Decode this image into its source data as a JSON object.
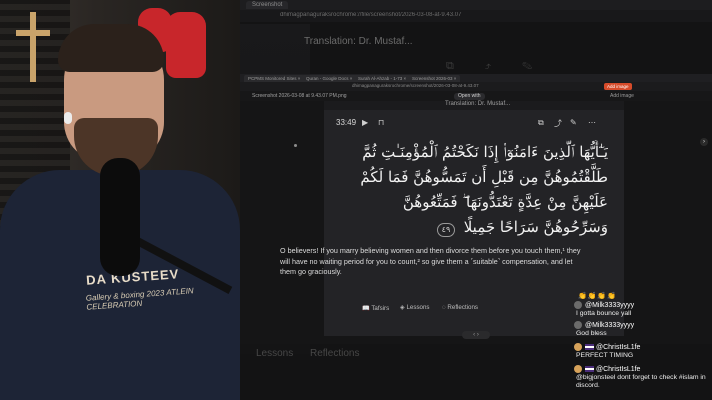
{
  "webcam": {
    "hoodie_title": "DA KUSTEEV",
    "hoodie_subtitle": "Gallery & boxing 2023 ATLEIN CELEBRATION"
  },
  "background_browser": {
    "tab_label": "Screenshot",
    "url": "dhimagpanaguraksrochrome://file/screenshot/2026-03-08-at-9.43.07",
    "translation_title": "Translation: Dr. Mustaf...",
    "lessons_label": "Lessons",
    "reflections_label": "Reflections"
  },
  "inner_browser": {
    "tabs": [
      "PCPMS Monitored Sites ×",
      "Quran - Google Docs ×",
      "Surah Al-Ahzab - 1-73 ×",
      "Screenshot 2026-03 ×"
    ],
    "url": "dhimagpanaguraksrochrome/screenshot/2026-03-08-at-9.43.07",
    "badge": "Add image",
    "file_name": "Screenshot 2026-03-08 at 9.43.07 PM.png",
    "open_with": "Open with",
    "right_label": "Add image"
  },
  "quran": {
    "card_top_label": "Translation: Dr. Mustaf...",
    "time": "33:49",
    "arabic_text": "يَـٰٓأَيُّهَا ٱلَّذِينَ ءَامَنُوٓا۟ إِذَا نَكَحْتُمُ ٱلْمُؤْمِنَـٰتِ ثُمَّ طَلَّقْتُمُوهُنَّ مِن قَبْلِ أَن تَمَسُّوهُنَّ فَمَا لَكُمْ عَلَيْهِنَّ مِنْ عِدَّةٍ تَعْتَدُّونَهَا ۖ فَمَتِّعُوهُنَّ وَسَرِّحُوهُنَّ سَرَاحًا جَمِيلًا",
    "verse_number": "٤٩",
    "translation": "O believers! If you marry believing women and then divorce them before you touch them,¹ they will have no waiting period for you to count,² so give them a ˹suitable˺ compensation, and let them go graciously.",
    "tabs": [
      "Tafsirs",
      "Lessons",
      "Reflections"
    ]
  },
  "chat": {
    "emotes": "👏👏👏👏",
    "messages": [
      {
        "user": "@Milk3333yyyy",
        "text": "I gotta bounce yall"
      },
      {
        "user": "@Milk3333yyyy",
        "text": "God bless"
      },
      {
        "user": "@ChristIsL1fe",
        "text": "PERFECT TIMING"
      },
      {
        "user": "@ChristIsL1fe",
        "text": "@bigjonsteel dont forget to check #islam in discord."
      }
    ]
  }
}
